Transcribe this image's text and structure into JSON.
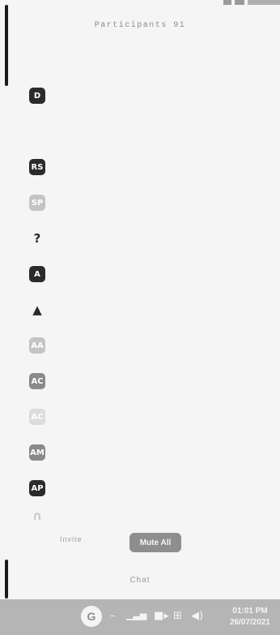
{
  "header": {
    "title": "Participants 91"
  },
  "participants": [
    {
      "initials": "D",
      "name": "",
      "tone": "dark"
    },
    {
      "initials": "",
      "name": "",
      "tone": "none"
    },
    {
      "initials": "RS",
      "name": "",
      "tone": "dark"
    },
    {
      "initials": "SP",
      "name": "",
      "tone": "light"
    },
    {
      "initials": "?",
      "name": "",
      "tone": "glyph"
    },
    {
      "initials": "A",
      "name": "",
      "tone": "dark"
    },
    {
      "initials": "▲",
      "name": "",
      "tone": "glyph"
    },
    {
      "initials": "AA",
      "name": "",
      "tone": "light"
    },
    {
      "initials": "AC",
      "name": "",
      "tone": "mid"
    },
    {
      "initials": "AC",
      "name": "",
      "tone": "faint"
    },
    {
      "initials": "AM",
      "name": "",
      "tone": "mid"
    },
    {
      "initials": "AP",
      "name": "",
      "tone": "dark"
    },
    {
      "initials": "∩",
      "name": "",
      "tone": "glyph-light"
    }
  ],
  "footer": {
    "invite_label": "Invite",
    "mute_all_label": "Mute All",
    "chat_label": "Chat"
  },
  "taskbar": {
    "time": "01:01 PM",
    "date": "26/07/2021",
    "icons": [
      "app-icon",
      "minus-icon",
      "signal-icon",
      "video-icon",
      "network-icon",
      "volume-icon"
    ]
  }
}
